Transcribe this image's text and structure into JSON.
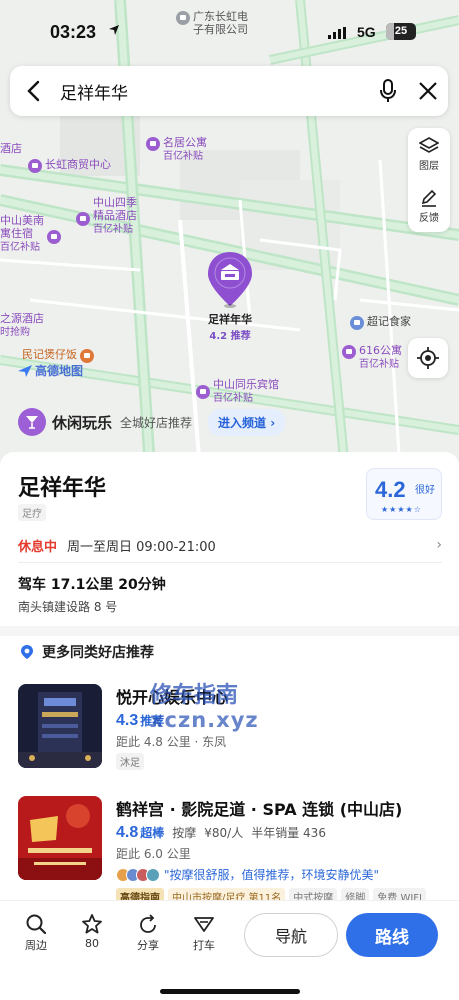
{
  "status_bar": {
    "time": "03:23",
    "network": "5G",
    "battery": "25"
  },
  "map": {
    "top_poi": "广东长虹电\n子有限公司",
    "pois": [
      {
        "name": "长虹商贸中心",
        "sub": ""
      },
      {
        "name": "名居公寓",
        "sub": "百亿补贴"
      },
      {
        "name": "中山四季\n精品酒店",
        "sub": "百亿补贴"
      },
      {
        "name": "中山美南\n寓住宿",
        "sub": "百亿补贴"
      },
      {
        "name": "超记食家",
        "sub": ""
      },
      {
        "name": "616公寓",
        "sub": "百亿补贴"
      },
      {
        "name": "中山同乐宾馆",
        "sub": "百亿补贴"
      },
      {
        "name": "民记煲仔饭",
        "sub": ""
      },
      {
        "name": "之源酒店",
        "sub": "时抢购"
      },
      {
        "name": "酒店",
        "sub": ""
      }
    ],
    "main_pin": {
      "name": "足祥年华",
      "rating": "4.2 推荐"
    },
    "logo": "高德地图",
    "layers_label": "图层",
    "feedback_label": "反馈"
  },
  "search": {
    "query": "足祥年华"
  },
  "leisure": {
    "title": "休闲玩乐",
    "subtitle": "全城好店推荐",
    "enter": "进入频道"
  },
  "shop": {
    "name": "足祥年华",
    "category": "足疗",
    "rating": "4.2",
    "rating_label": "很好",
    "stars": "★★★★☆",
    "status": "休息中",
    "hours": "周一至周日 09:00-21:00",
    "drive": "驾车 17.1公里  20分钟",
    "address": "南头镇建设路 8 号"
  },
  "recommend": {
    "title": "更多同类好店推荐",
    "items": [
      {
        "name": "悦开心娱乐中心",
        "score": "4.3",
        "score_label": "推荐",
        "distance": "距此 4.8 公里 · 东凤",
        "tag": "沐足"
      },
      {
        "name": "鹤祥宫 · 影院足道 · SPA 连锁 (中山店)",
        "score": "4.8",
        "score_label": "超棒",
        "category": "按摩",
        "price": "¥80/人",
        "sales": "半年销量 436",
        "distance": "距此 6.0 公里",
        "quote": "\"按摩很舒服，值得推荐，环境安静优美\"",
        "gold": "高德指南",
        "rank": "中山市按摩/足疗 第11名",
        "tags": [
          "中式按摩",
          "修脚",
          "免费 WIFI"
        ]
      }
    ]
  },
  "watermark": {
    "line1": "修车指南",
    "line2": "xczn.xyz"
  },
  "bottom": {
    "nearby": "周边",
    "favorites": "80",
    "share": "分享",
    "taxi": "打车",
    "navigate": "导航",
    "route": "路线"
  }
}
